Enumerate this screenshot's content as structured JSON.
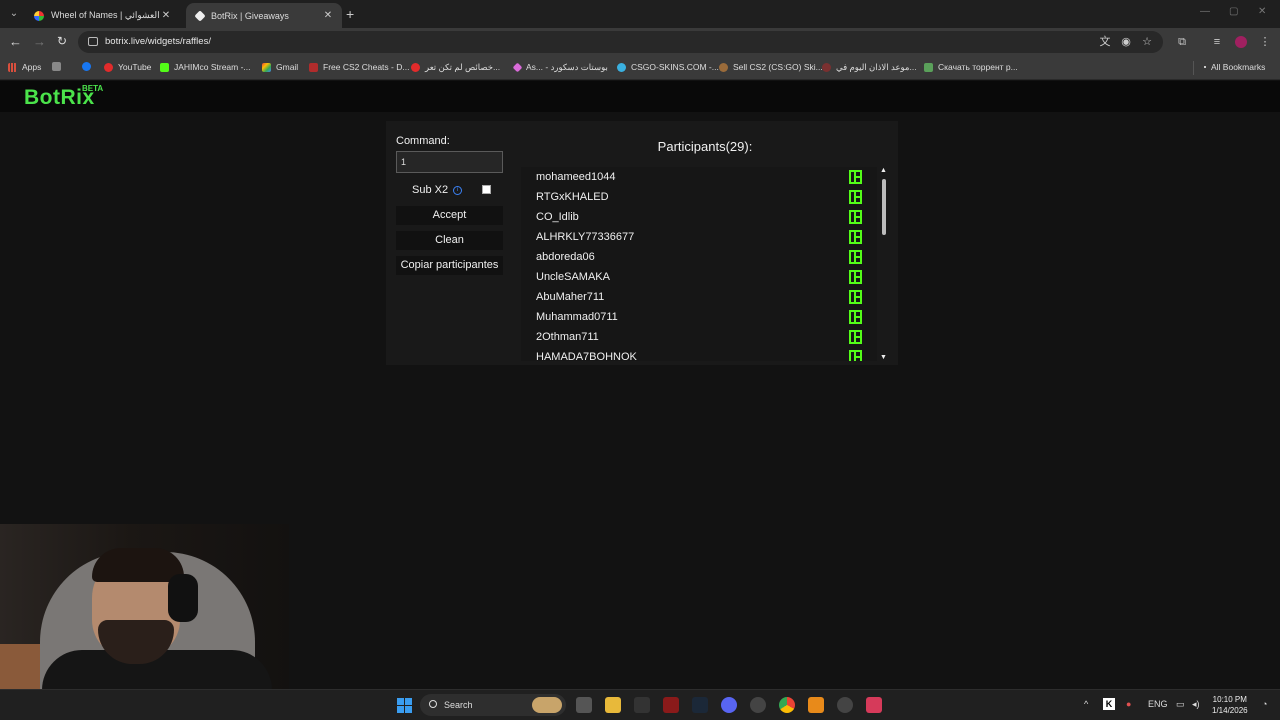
{
  "browser": {
    "tabs": [
      {
        "title": "Wheel of Names | اسم العشوائي",
        "active": false
      },
      {
        "title": "BotRix | Giveaways",
        "active": true
      }
    ],
    "url": "botrix.live/widgets/raffles/",
    "bookmarks": [
      {
        "label": "Apps",
        "color": "#d94f3d"
      },
      {
        "label": "YouTube",
        "color": "#e22b2b"
      },
      {
        "label": "JAHIMco Stream -...",
        "color": "#53fc18"
      },
      {
        "label": "Gmail",
        "color": "#c7c7c7"
      },
      {
        "label": "Free CS2 Cheats - D...",
        "color": "#b02c2c"
      },
      {
        "label": "خصائص لم تكن تعر...",
        "color": "#e22b2b"
      },
      {
        "label": "As... - بوستات دسكورد",
        "color": "#d96bd9"
      },
      {
        "label": "CSGO-SKINS.COM -...",
        "color": "#3ab0e0"
      },
      {
        "label": "Sell CS2 (CS:GO) Ski...",
        "color": "#9a6b3a"
      },
      {
        "label": "موعد الاذان اليوم في...",
        "color": "#7a3030"
      },
      {
        "label": "Скачать торрент р...",
        "color": "#5aa05a"
      }
    ],
    "all_bookmarks": "All Bookmarks"
  },
  "app": {
    "logo": "BotRix",
    "badge": "BETA"
  },
  "widget": {
    "command_label": "Command:",
    "command_value": "1",
    "sub_label": "Sub X2",
    "sub_checked": false,
    "accept": "Accept",
    "clean": "Clean",
    "copy": "Copiar participantes",
    "participants_title": "Participants(29):",
    "participants": [
      "mohameed1044",
      "RTGxKHALED",
      "CO_Idlib",
      "ALHRKLY77336677",
      "abdoreda06",
      "UncleSAMAKA",
      "AbuMaher711",
      "Muhammad0711",
      "2Othman711",
      "HAMADA7BOHNOK"
    ]
  },
  "taskbar": {
    "search": "Search",
    "lang": "ENG",
    "time": "10:10 PM",
    "date": "1/14/2026"
  },
  "colors": {
    "accent": "#4be34b",
    "kick_green": "#53fc18"
  }
}
